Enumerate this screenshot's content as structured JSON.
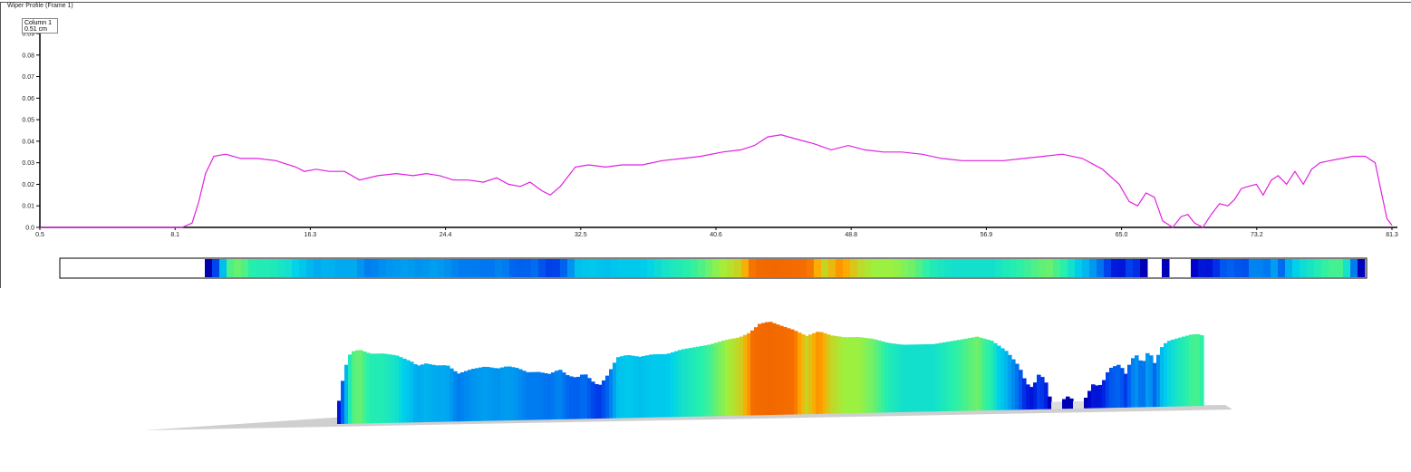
{
  "window": {
    "title": "Wiper Profile (Frame 1)"
  },
  "cursor": {
    "label": "Column 1",
    "value": "0.51 cm"
  },
  "colors": {
    "profile_line": "#e020e0",
    "axis": "#000000",
    "floor": "#cfcfcf"
  },
  "chart_data": {
    "type": "line",
    "x_ticks": [
      "0.5",
      "8.1",
      "16.3",
      "24.4",
      "32.5",
      "40.6",
      "48.8",
      "56.9",
      "65.0",
      "73.2",
      "81.3"
    ],
    "y_ticks": [
      "0.0",
      "0.01",
      "0.02",
      "0.03",
      "0.04",
      "0.05",
      "0.06",
      "0.07",
      "0.08",
      "0.09"
    ],
    "xlim": [
      0.5,
      81.3
    ],
    "ylim": [
      0,
      0.09
    ],
    "grid": false,
    "x": [
      0.5,
      3,
      6,
      9,
      9.6,
      10,
      10.4,
      10.9,
      11.6,
      12.5,
      13.5,
      14.6,
      15.8,
      16.3,
      17,
      17.8,
      18.7,
      19.6,
      20.7,
      21.8,
      22.8,
      23.6,
      24.4,
      25.2,
      26.1,
      27,
      27.8,
      28.5,
      29.2,
      29.8,
      30.5,
      31,
      31.6,
      32.5,
      33.3,
      34.3,
      35.3,
      36.5,
      37.7,
      38.9,
      40,
      41.3,
      42.4,
      43.2,
      44,
      44.8,
      45.7,
      46.7,
      47.8,
      48.8,
      49.8,
      50.9,
      52,
      53.2,
      54.4,
      55.6,
      56.9,
      58.1,
      59.3,
      60.5,
      61.6,
      62.8,
      64,
      65,
      65.6,
      66.1,
      66.6,
      67.1,
      67.6,
      68.2,
      68.7,
      69.1,
      69.5,
      70,
      70.5,
      71,
      71.5,
      71.9,
      72.3,
      72.7,
      73.2,
      73.6,
      74.1,
      74.5,
      75,
      75.5,
      76,
      76.5,
      77,
      77.6,
      78.3,
      79,
      79.7,
      80.3,
      80.7,
      81,
      81.3
    ],
    "values": [
      0,
      0,
      0,
      0,
      0.002,
      0.012,
      0.025,
      0.033,
      0.034,
      0.032,
      0.032,
      0.031,
      0.028,
      0.026,
      0.027,
      0.026,
      0.026,
      0.022,
      0.024,
      0.025,
      0.024,
      0.025,
      0.024,
      0.022,
      0.022,
      0.021,
      0.023,
      0.02,
      0.019,
      0.021,
      0.017,
      0.015,
      0.019,
      0.028,
      0.029,
      0.028,
      0.029,
      0.029,
      0.031,
      0.032,
      0.033,
      0.035,
      0.036,
      0.038,
      0.042,
      0.043,
      0.041,
      0.039,
      0.036,
      0.038,
      0.036,
      0.035,
      0.035,
      0.034,
      0.032,
      0.031,
      0.031,
      0.031,
      0.032,
      0.033,
      0.034,
      0.032,
      0.027,
      0.02,
      0.012,
      0.01,
      0.016,
      0.014,
      0.003,
      0.0,
      0.005,
      0.006,
      0.002,
      0.0,
      0.006,
      0.011,
      0.01,
      0.013,
      0.018,
      0.019,
      0.02,
      0.015,
      0.022,
      0.024,
      0.02,
      0.026,
      0.02,
      0.027,
      0.03,
      0.031,
      0.032,
      0.033,
      0.033,
      0.03,
      0.015,
      0.004,
      0.001
    ]
  }
}
